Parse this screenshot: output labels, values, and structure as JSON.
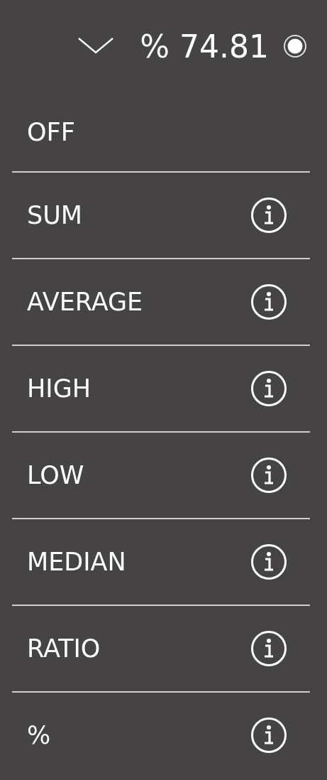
{
  "header": {
    "value": "% 74.81",
    "on": true
  },
  "menu": [
    {
      "label": "OFF",
      "info": false
    },
    {
      "label": "SUM",
      "info": true
    },
    {
      "label": "AVERAGE",
      "info": true
    },
    {
      "label": "HIGH",
      "info": true
    },
    {
      "label": "LOW",
      "info": true
    },
    {
      "label": "MEDIAN",
      "info": true
    },
    {
      "label": "RATIO",
      "info": true
    },
    {
      "label": "%",
      "info": true
    }
  ]
}
